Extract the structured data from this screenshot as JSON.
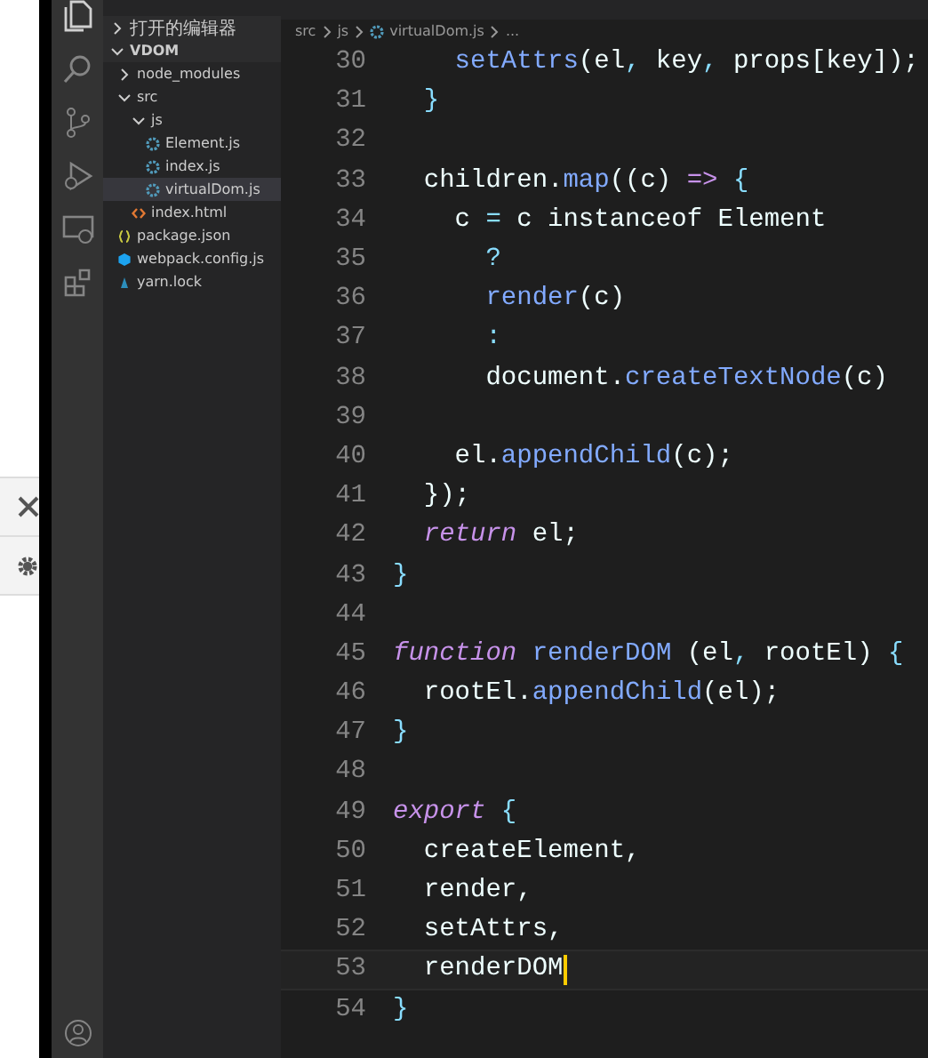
{
  "sidebar": {
    "sections": [
      {
        "label": "打开的编辑器",
        "expanded": false
      },
      {
        "label": "VDOM",
        "expanded": true,
        "children": [
          {
            "label": "node_modules",
            "kind": "folder",
            "expanded": false,
            "selected": false
          },
          {
            "label": "src",
            "kind": "folder",
            "expanded": true,
            "selected": false,
            "children": [
              {
                "label": "js",
                "kind": "folder",
                "expanded": true,
                "selected": false,
                "children": [
                  {
                    "label": "Element.js",
                    "kind": "js",
                    "selected": false
                  },
                  {
                    "label": "index.js",
                    "kind": "js",
                    "selected": false
                  },
                  {
                    "label": "virtualDom.js",
                    "kind": "js",
                    "selected": true
                  }
                ]
              },
              {
                "label": "index.html",
                "kind": "html",
                "selected": false
              }
            ]
          },
          {
            "label": "package.json",
            "kind": "json",
            "selected": false
          },
          {
            "label": "webpack.config.js",
            "kind": "webpack",
            "selected": false
          },
          {
            "label": "yarn.lock",
            "kind": "yarn",
            "selected": false
          }
        ]
      }
    ]
  },
  "breadcrumb": [
    "src",
    "js",
    "virtualDom.js",
    "..."
  ],
  "editor": {
    "lines": [
      {
        "number": "30",
        "tokens": [
          {
            "t": "    setAttrs",
            "kind": "function"
          },
          {
            "t": "(el",
            "kind": "plain"
          },
          {
            "t": ",",
            "kind": "punctuation"
          },
          {
            "t": " key",
            "kind": "plain"
          },
          {
            "t": ",",
            "kind": "punctuation"
          },
          {
            "t": " props[key]);",
            "kind": "plain"
          }
        ]
      },
      {
        "number": "31",
        "tokens": [
          {
            "t": "  }",
            "kind": "punctuation"
          }
        ]
      },
      {
        "number": "32"
      },
      {
        "number": "33",
        "tokens": [
          {
            "t": "  children.",
            "kind": "plain"
          },
          {
            "t": "map",
            "kind": "function"
          },
          {
            "t": "((c) ",
            "kind": "plain"
          },
          {
            "t": "=>",
            "kind": "keyword"
          },
          {
            "t": " {",
            "kind": "punctuation"
          }
        ]
      },
      {
        "number": "34",
        "tokens": [
          {
            "t": "    c ",
            "kind": "plain"
          },
          {
            "t": "=",
            "kind": "punctuation"
          },
          {
            "t": " c instanceof Element",
            "kind": "plain"
          }
        ]
      },
      {
        "number": "35",
        "tokens": [
          {
            "t": "      ?",
            "kind": "punctuation"
          }
        ]
      },
      {
        "number": "36",
        "tokens": [
          {
            "t": "      render",
            "kind": "function"
          },
          {
            "t": "(c)",
            "kind": "plain"
          }
        ]
      },
      {
        "number": "37",
        "tokens": [
          {
            "t": "      :",
            "kind": "punctuation"
          }
        ]
      },
      {
        "number": "38",
        "tokens": [
          {
            "t": "      document.",
            "kind": "plain"
          },
          {
            "t": "createTextNode",
            "kind": "function"
          },
          {
            "t": "(c)",
            "kind": "plain"
          }
        ]
      },
      {
        "number": "39"
      },
      {
        "number": "40",
        "tokens": [
          {
            "t": "    el.",
            "kind": "plain"
          },
          {
            "t": "appendChild",
            "kind": "function"
          },
          {
            "t": "(c);",
            "kind": "plain"
          }
        ]
      },
      {
        "number": "41",
        "tokens": [
          {
            "t": "  });",
            "kind": "plain"
          }
        ]
      },
      {
        "number": "42",
        "tokens": [
          {
            "t": "  return",
            "kind": "keyword"
          },
          {
            "t": " el;",
            "kind": "plain"
          }
        ]
      },
      {
        "number": "43",
        "tokens": [
          {
            "t": "}",
            "kind": "punctuation"
          }
        ]
      },
      {
        "number": "44"
      },
      {
        "number": "45",
        "tokens": [
          {
            "t": "function",
            "kind": "keyword"
          },
          {
            "t": " renderDOM",
            "kind": "function"
          },
          {
            "t": " (el",
            "kind": "plain"
          },
          {
            "t": ",",
            "kind": "punctuation"
          },
          {
            "t": " rootEl) ",
            "kind": "plain"
          },
          {
            "t": "{",
            "kind": "punctuation"
          }
        ]
      },
      {
        "number": "46",
        "tokens": [
          {
            "t": "  rootEl.",
            "kind": "plain"
          },
          {
            "t": "appendChild",
            "kind": "function"
          },
          {
            "t": "(el);",
            "kind": "plain"
          }
        ]
      },
      {
        "number": "47",
        "tokens": [
          {
            "t": "}",
            "kind": "punctuation"
          }
        ]
      },
      {
        "number": "48"
      },
      {
        "number": "49",
        "tokens": [
          {
            "t": "export",
            "kind": "keyword"
          },
          {
            "t": " {",
            "kind": "punctuation"
          }
        ]
      },
      {
        "number": "50",
        "tokens": [
          {
            "t": "  createElement,",
            "kind": "plain"
          }
        ]
      },
      {
        "number": "51",
        "tokens": [
          {
            "t": "  render,",
            "kind": "plain"
          }
        ]
      },
      {
        "number": "52",
        "tokens": [
          {
            "t": "  setAttrs,",
            "kind": "plain"
          }
        ]
      },
      {
        "number": "53",
        "current": true,
        "tokens": [
          {
            "t": "  renderDOM",
            "kind": "plain"
          }
        ]
      },
      {
        "number": "54",
        "tokens": [
          {
            "t": "}",
            "kind": "punctuation"
          }
        ]
      }
    ]
  }
}
